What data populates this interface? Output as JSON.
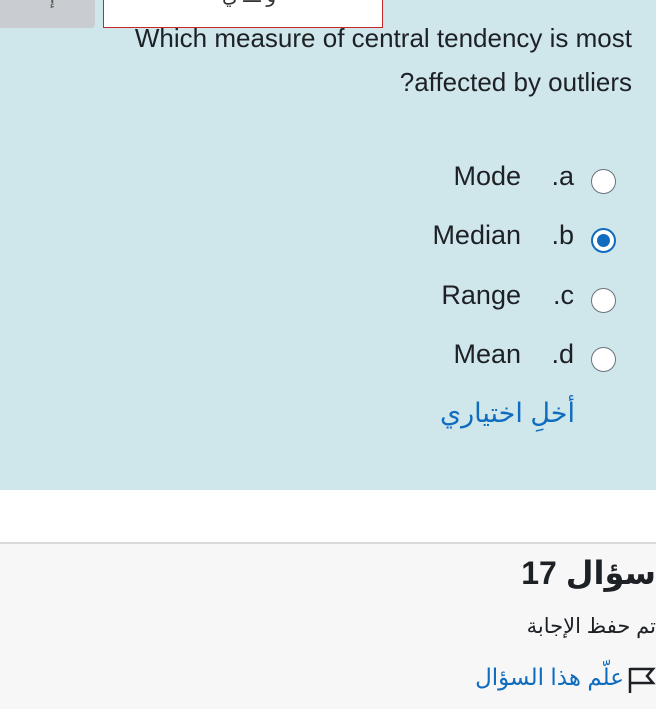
{
  "top": {
    "chip_text": "إ",
    "box_text": "و ـــ ي"
  },
  "question": {
    "line1": "Which measure of central tendency is most",
    "line2": "?affected by outliers"
  },
  "options": [
    {
      "letter": ".a",
      "text": "Mode",
      "checked": false
    },
    {
      "letter": ".b",
      "text": "Median",
      "checked": true
    },
    {
      "letter": ".c",
      "text": "Range",
      "checked": false
    },
    {
      "letter": ".d",
      "text": "Mean",
      "checked": false
    }
  ],
  "clear_choice": "أخلِ اختياري",
  "info": {
    "question_label": "سؤال",
    "question_number": "17",
    "status": "تم حفظ الإجابة",
    "flag_text": "علّم هذا السؤال"
  },
  "colors": {
    "panel_bg": "#cfe6ea",
    "accent": "#0f6cbf",
    "info_bg": "#f7f7f8"
  }
}
